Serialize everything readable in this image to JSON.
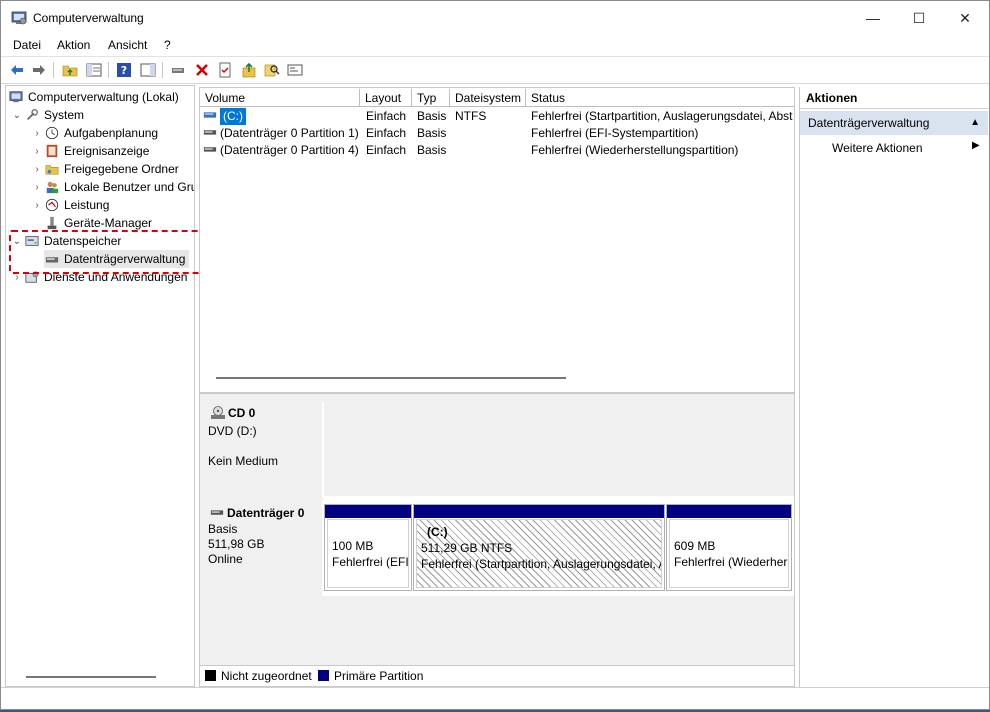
{
  "window": {
    "title": "Computerverwaltung",
    "controls": {
      "minimize": "—",
      "maximize": "☐",
      "close": "✕"
    }
  },
  "menubar": [
    "Datei",
    "Aktion",
    "Ansicht",
    "?"
  ],
  "toolbar": {
    "icons": [
      "back-arrow-icon",
      "forward-arrow-icon",
      "up-folder-icon",
      "show-tree-icon",
      "help-icon",
      "show-action-pane-icon",
      "connect-icon",
      "delete-icon",
      "properties-icon",
      "export-icon",
      "search-icon",
      "console-icon"
    ]
  },
  "tree": {
    "root": "Computerverwaltung (Lokal)",
    "system": "System",
    "items": [
      "Aufgabenplanung",
      "Ereignisanzeige",
      "Freigegebene Ordner",
      "Lokale Benutzer und Gru",
      "Leistung",
      "Geräte-Manager"
    ],
    "storage": "Datenspeicher",
    "disk_mgmt": "Datenträgerverwaltung",
    "services": "Dienste und Anwendungen"
  },
  "volume_list": {
    "columns": [
      "Volume",
      "Layout",
      "Typ",
      "Dateisystem",
      "Status"
    ],
    "rows": [
      {
        "volume": "(C:)",
        "layout": "Einfach",
        "typ": "Basis",
        "fs": "NTFS",
        "status": "Fehlerfrei (Startpartition, Auslagerungsdatei, Absturz"
      },
      {
        "volume": "(Datenträger 0 Partition 1)",
        "layout": "Einfach",
        "typ": "Basis",
        "fs": "",
        "status": "Fehlerfrei (EFI-Systempartition)"
      },
      {
        "volume": "(Datenträger 0 Partition 4)",
        "layout": "Einfach",
        "typ": "Basis",
        "fs": "",
        "status": "Fehlerfrei (Wiederherstellungspartition)"
      }
    ]
  },
  "disks": {
    "cd": {
      "name": "CD 0",
      "line1": "DVD (D:)",
      "line2": "Kein Medium"
    },
    "disk0": {
      "name": "Datenträger 0",
      "type": "Basis",
      "size": "511,98 GB",
      "state": "Online",
      "partitions": [
        {
          "title": "",
          "size": "100 MB",
          "status": "Fehlerfrei (EFI-"
        },
        {
          "title": "(C:)",
          "size": "511,29 GB NTFS",
          "status": "Fehlerfrei (Startpartition, Auslagerungsdatei, A"
        },
        {
          "title": "",
          "size": "609 MB",
          "status": "Fehlerfrei (Wiederher"
        }
      ]
    }
  },
  "legend": {
    "unallocated": "Nicht zugeordnet",
    "primary": "Primäre Partition"
  },
  "actions": {
    "header": "Aktionen",
    "section": "Datenträgerverwaltung",
    "item": "Weitere Aktionen"
  },
  "colors": {
    "primary_partition": "#000080",
    "unallocated": "#000000",
    "highlight": "#d8000d",
    "selection": "#0078d7"
  }
}
